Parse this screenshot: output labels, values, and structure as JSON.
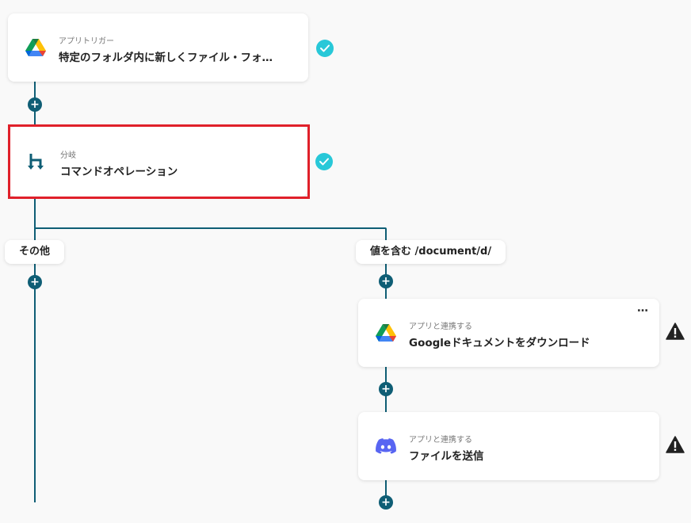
{
  "flow": {
    "trigger": {
      "subtitle": "アプリトリガー",
      "title": "特定のフォルダ内に新しくファイル・フォ…",
      "icon": "google-drive-icon",
      "status": "check-icon"
    },
    "branch": {
      "subtitle": "分岐",
      "title": "コマンドオペレーション",
      "icon": "branch-icon",
      "status": "check-icon"
    },
    "branches": {
      "left_label": "その他",
      "right_label": "値を含む /document/d/"
    },
    "step_download": {
      "subtitle": "アプリと連携する",
      "title": "Googleドキュメントをダウンロード",
      "icon": "google-drive-icon",
      "menu": "…",
      "status": "warning-icon"
    },
    "step_send": {
      "subtitle": "アプリと連携する",
      "title": "ファイルを送信",
      "icon": "discord-icon",
      "status": "warning-icon"
    }
  },
  "colors": {
    "line": "#0f5e75",
    "check": "#28c8d8",
    "highlight": "#e0202a",
    "warning": "#222222",
    "discord": "#5865f2"
  }
}
